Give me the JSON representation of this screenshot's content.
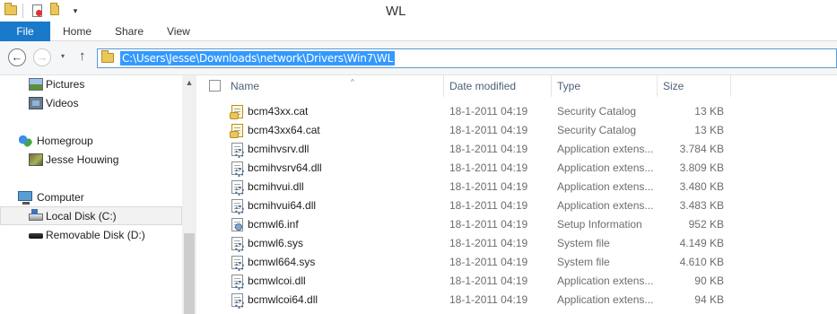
{
  "window": {
    "title": "WL",
    "quick_access_icons": [
      "folder-icon",
      "properties-icon",
      "new-folder-icon",
      "customize-dropdown-icon"
    ]
  },
  "ribbon": {
    "tabs": [
      "File",
      "Home",
      "Share",
      "View"
    ]
  },
  "navigation": {
    "back_icon": "←",
    "forward_icon": "→",
    "recent_icon": "▾",
    "up_icon": "↑",
    "address": "C:\\Users\\Jesse\\Downloads\\network\\Drivers\\Win7\\WL"
  },
  "nav_pane": {
    "items": [
      {
        "label": "Pictures",
        "icon": "pictures-icon"
      },
      {
        "label": "Videos",
        "icon": "videos-icon"
      },
      {
        "label": "Homegroup",
        "icon": "homegroup-icon"
      },
      {
        "label": "Jesse Houwing",
        "icon": "user-icon"
      },
      {
        "label": "Computer",
        "icon": "computer-icon"
      },
      {
        "label": "Local Disk (C:)",
        "icon": "local-disk-icon",
        "selected": true
      },
      {
        "label": "Removable Disk (D:)",
        "icon": "removable-disk-icon"
      }
    ],
    "scroll_up_icon": "▲"
  },
  "file_list": {
    "columns": {
      "name": "Name",
      "date": "Date modified",
      "type": "Type",
      "size": "Size"
    },
    "sort_indicator": "^",
    "files": [
      {
        "name": "bcm43xx.cat",
        "date": "18-1-2011 04:19",
        "type": "Security Catalog",
        "size": "13 KB",
        "icon": "catalog"
      },
      {
        "name": "bcm43xx64.cat",
        "date": "18-1-2011 04:19",
        "type": "Security Catalog",
        "size": "13 KB",
        "icon": "catalog"
      },
      {
        "name": "bcmihvsrv.dll",
        "date": "18-1-2011 04:19",
        "type": "Application extens...",
        "size": "3.784 KB",
        "icon": "dll"
      },
      {
        "name": "bcmihvsrv64.dll",
        "date": "18-1-2011 04:19",
        "type": "Application extens...",
        "size": "3.809 KB",
        "icon": "dll"
      },
      {
        "name": "bcmihvui.dll",
        "date": "18-1-2011 04:19",
        "type": "Application extens...",
        "size": "3.480 KB",
        "icon": "dll"
      },
      {
        "name": "bcmihvui64.dll",
        "date": "18-1-2011 04:19",
        "type": "Application extens...",
        "size": "3.483 KB",
        "icon": "dll"
      },
      {
        "name": "bcmwl6.inf",
        "date": "18-1-2011 04:19",
        "type": "Setup Information",
        "size": "952 KB",
        "icon": "inf"
      },
      {
        "name": "bcmwl6.sys",
        "date": "18-1-2011 04:19",
        "type": "System file",
        "size": "4.149 KB",
        "icon": "sys"
      },
      {
        "name": "bcmwl664.sys",
        "date": "18-1-2011 04:19",
        "type": "System file",
        "size": "4.610 KB",
        "icon": "sys"
      },
      {
        "name": "bcmwlcoi.dll",
        "date": "18-1-2011 04:19",
        "type": "Application extens...",
        "size": "90 KB",
        "icon": "dll"
      },
      {
        "name": "bcmwlcoi64.dll",
        "date": "18-1-2011 04:19",
        "type": "Application extens...",
        "size": "94 KB",
        "icon": "dll"
      }
    ]
  },
  "colors": {
    "file_tab": "#1979ca",
    "selection": "#3399ff",
    "header_text": "#4c607a"
  }
}
